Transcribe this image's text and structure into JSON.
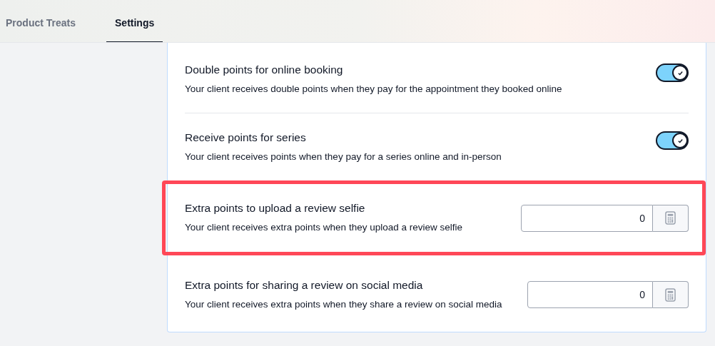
{
  "tabs": [
    {
      "label": "Product Treats",
      "selected": false
    },
    {
      "label": "Settings",
      "selected": true
    }
  ],
  "settings": [
    {
      "kind": "toggle",
      "title": "Double points for online booking",
      "description": "Your client receives double points when they pay for the appointment they booked online",
      "on": true,
      "highlighted": false
    },
    {
      "kind": "toggle",
      "title": "Receive points for series",
      "description": "Your client receives points when they pay for a series online and in-person",
      "on": true,
      "highlighted": false
    },
    {
      "kind": "number",
      "title": "Extra points to upload a review selfie",
      "description": "Your client receives extra points when they upload a review selfie",
      "value": "0",
      "highlighted": true
    },
    {
      "kind": "number",
      "title": "Extra points for sharing a review on social media",
      "description": "Your client receives extra points when they share a review on social media",
      "value": "0",
      "highlighted": false
    }
  ]
}
